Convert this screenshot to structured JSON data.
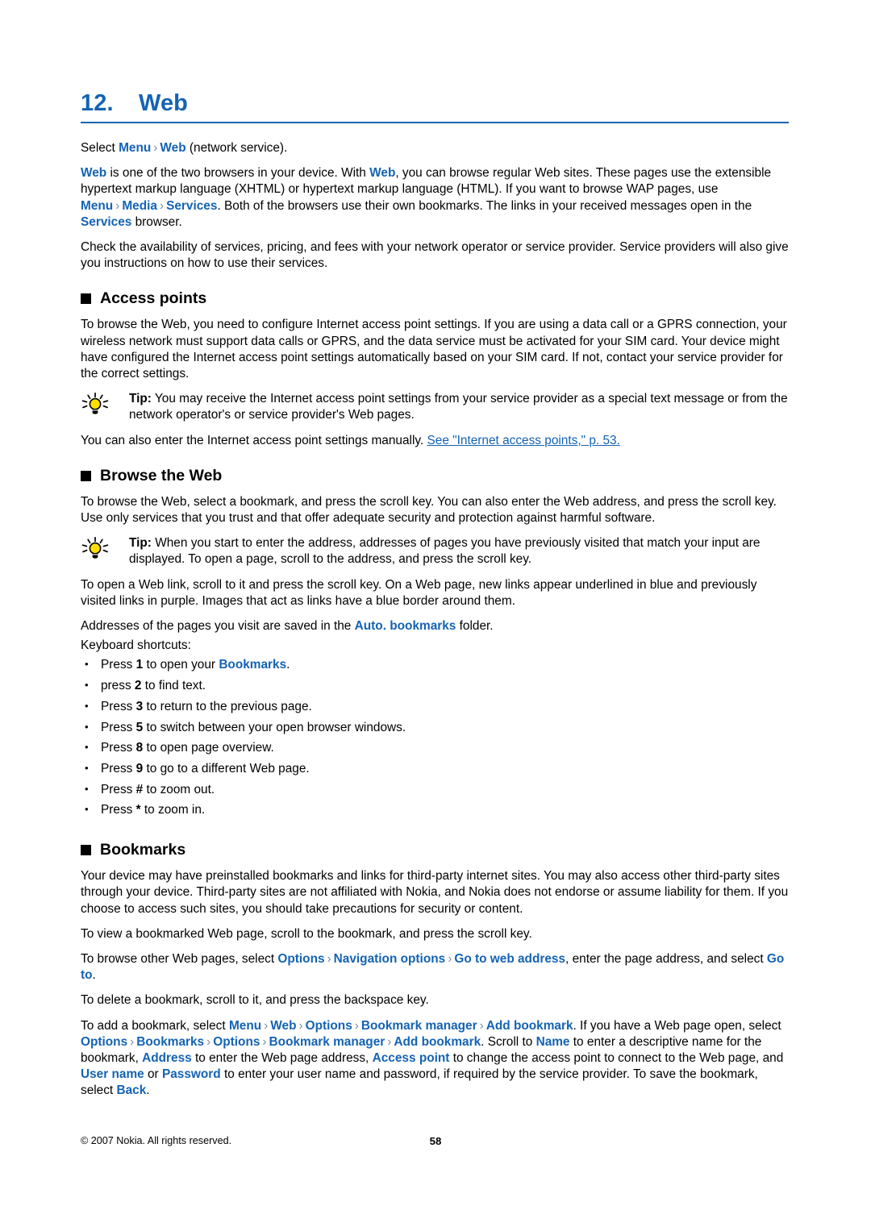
{
  "document": {
    "chapter_number": "12.",
    "chapter_title": "Web",
    "intro_select": "Select",
    "intro_menu": "Menu",
    "intro_web": "Web",
    "intro_tail": "(network service)."
  },
  "icons": {
    "tip_icon": "lightbulb-icon",
    "section_bullet": "black-square-bullet",
    "separator": "angle-bracket-separator"
  },
  "colors": {
    "accent_blue": "#1463b4",
    "separator_grey": "#8190a4",
    "bulb_yellow": "#ffe000",
    "text_black": "#000000"
  },
  "intro": {
    "para1": {
      "t1": "Web",
      "t2": " is one of the two browsers in your device. With ",
      "t3": "Web",
      "t4": ", you can browse regular Web sites. These pages use the extensible hypertext markup language (XHTML) or hypertext markup language (HTML). If you want to browse WAP pages, use ",
      "t5": "Menu",
      "t6": "Media",
      "t7": "Services",
      "t8": ". Both of the browsers use their own bookmarks. The links in your received messages open in the ",
      "t9": "Services",
      "t10": " browser."
    },
    "para2": "Check the availability of services, pricing, and fees with your network operator or service provider. Service providers will also give you instructions on how to use their services."
  },
  "access_points": {
    "heading": "Access points",
    "para1": "To browse the Web, you need to configure Internet access point settings. If you are using a data call or a GPRS connection, your wireless network must support data calls or GPRS, and the data service must be activated for your SIM card. Your device might have configured the Internet access point settings automatically based on your SIM card. If not, contact your service provider for the correct settings.",
    "tip_label": "Tip:",
    "tip_text": " You may receive the Internet access point settings from your service provider as a special text message or from the network operator's or service provider's Web pages.",
    "manual_lead": "You can also enter the Internet access point settings manually. ",
    "manual_xref": "See \"Internet access points,\" p. 53."
  },
  "browse_the_web": {
    "heading": "Browse the Web",
    "para1": "To browse the Web, select a bookmark, and press the scroll key. You can also enter the Web address, and press the scroll key. Use only services that you trust and that offer adequate security and protection against harmful software.",
    "tip_label": "Tip:",
    "tip_text": " When you start to enter the address, addresses of pages you have previously visited that match your input are displayed. To open a page, scroll to the address, and press the scroll key.",
    "para2": "To open a Web link, scroll to it and press the scroll key. On a Web page, new links appear underlined in blue and previously visited links in purple. Images that act as links have a blue border around them.",
    "para3_lead": "Addresses of the pages you visit are saved in the ",
    "para3_ui": "Auto. bookmarks",
    "para3_tail": " folder.",
    "shortcuts_label": "Keyboard shortcuts:",
    "shortcuts": [
      {
        "lead": "Press ",
        "key": "1",
        "mid": " to open your ",
        "ui": "Bookmarks",
        "tail": "."
      },
      {
        "lead": "press ",
        "key": "2",
        "mid": " to find text.",
        "ui": "",
        "tail": ""
      },
      {
        "lead": "Press ",
        "key": "3",
        "mid": " to return to the previous page.",
        "ui": "",
        "tail": ""
      },
      {
        "lead": "Press ",
        "key": "5",
        "mid": " to switch between your open browser windows.",
        "ui": "",
        "tail": ""
      },
      {
        "lead": "Press ",
        "key": "8",
        "mid": " to open page overview.",
        "ui": "",
        "tail": ""
      },
      {
        "lead": "Press ",
        "key": "9",
        "mid": " to go to a different Web page.",
        "ui": "",
        "tail": ""
      },
      {
        "lead": "Press ",
        "key": "#",
        "mid": " to zoom out.",
        "ui": "",
        "tail": ""
      },
      {
        "lead": "Press ",
        "key": "*",
        "mid": " to zoom in.",
        "ui": "",
        "tail": ""
      }
    ]
  },
  "bookmarks": {
    "heading": "Bookmarks",
    "para1": "Your device may have preinstalled bookmarks and links for third-party internet sites. You may also access other third-party sites through your device. Third-party sites are not affiliated with Nokia, and Nokia does not endorse or assume liability for them. If you choose to access such sites, you should take precautions for security or content.",
    "para2": "To view a bookmarked Web page, scroll to the bookmark, and press the scroll key.",
    "para3": {
      "t1": "To browse other Web pages, select ",
      "ui1": "Options",
      "ui2": "Navigation options",
      "ui3": "Go to web address",
      "t2": ", enter the page address, and select ",
      "ui4": "Go to",
      "t3": "."
    },
    "para4": "To delete a bookmark, scroll to it, and press the backspace key.",
    "para5": {
      "t1": "To add a bookmark, select ",
      "ui1": "Menu",
      "ui2": "Web",
      "ui3": "Options",
      "ui4": "Bookmark manager",
      "ui5": "Add bookmark",
      "t2": ". If you have a Web page open, select ",
      "ui6": "Options",
      "ui7": "Bookmarks",
      "ui8": "Options",
      "ui9": "Bookmark manager",
      "ui10": "Add bookmark",
      "t3": ". Scroll to ",
      "ui11": "Name",
      "t4": " to enter a descriptive name for the bookmark, ",
      "ui12": "Address",
      "t5": " to enter the Web page address, ",
      "ui13": "Access point",
      "t6": " to change the access point to connect to the Web page, and ",
      "ui14": "User name",
      "t7": " or ",
      "ui15": "Password",
      "t8": " to enter your user name and password, if required by the service provider. To save the bookmark, select ",
      "ui16": "Back",
      "t9": "."
    }
  },
  "footer": {
    "copyright": "© 2007 Nokia. All rights reserved.",
    "page_number": "58"
  }
}
